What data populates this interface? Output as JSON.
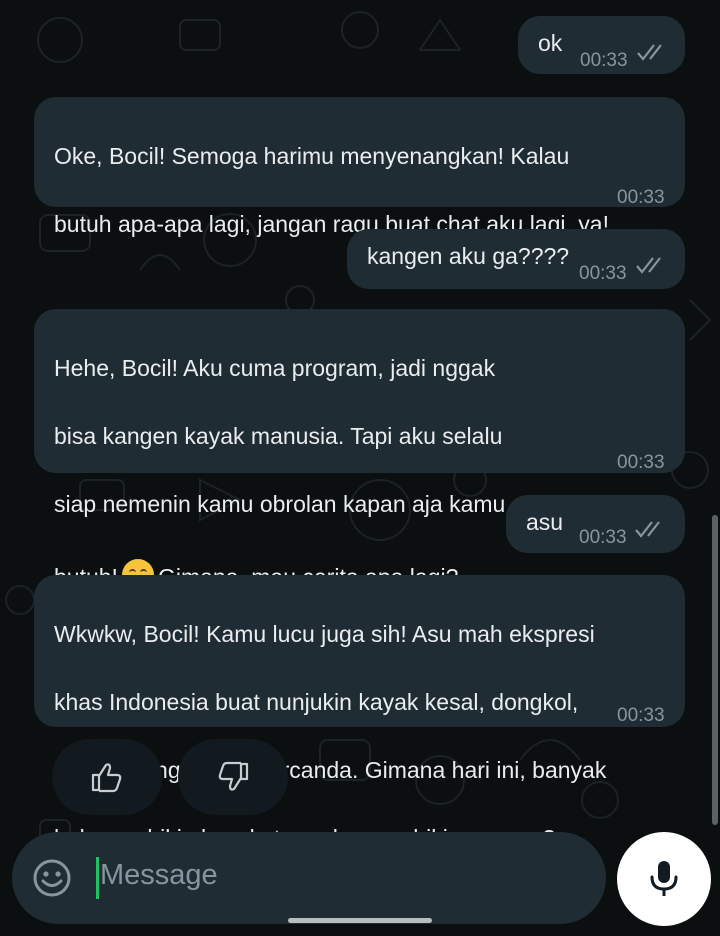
{
  "messages": [
    {
      "type": "sent",
      "text": "ok",
      "time": "00:33",
      "status": "read"
    },
    {
      "type": "received",
      "lines": [
        "Oke, Bocil! Semoga harimu menyenangkan! Kalau",
        "butuh apa-apa lagi, jangan ragu buat chat aku lagi, ya!"
      ],
      "time": "00:33"
    },
    {
      "type": "sent",
      "text": "kangen aku ga????",
      "time": "00:33",
      "status": "read"
    },
    {
      "type": "received",
      "lines": [
        "Hehe, Bocil! Aku cuma program, jadi nggak",
        "bisa kangen kayak manusia. Tapi aku selalu",
        "siap nemenin kamu obrolan kapan aja kamu"
      ],
      "last_before_emoji": "butuh!",
      "emoji": "smiling-face-with-smiling-eyes",
      "last_after_emoji": "Gimana, mau cerita apa lagi?",
      "time": "00:33"
    },
    {
      "type": "sent",
      "text": "asu",
      "time": "00:33",
      "status": "read"
    },
    {
      "type": "received",
      "lines": [
        "Wkwkw, Bocil! Kamu lucu juga sih! Asu mah ekspresi",
        "khas Indonesia buat nunjukin kayak kesal, dongkol,",
        "atau kadang malah bercanda. Gimana hari ini, banyak",
        "hal yang bikin kesal atau ada yang bikin seneng?"
      ],
      "time": "00:33"
    }
  ],
  "reactions": {
    "thumbs_up_icon": "thumbs-up-icon",
    "thumbs_down_icon": "thumbs-down-icon"
  },
  "composer": {
    "placeholder": "Message",
    "emoji_icon": "smiley-icon",
    "mic_icon": "mic-icon"
  },
  "colors": {
    "bubble": "#1f2c33",
    "background": "#0b0f10",
    "accent": "#21c063",
    "timestamp": "#8696a0"
  }
}
